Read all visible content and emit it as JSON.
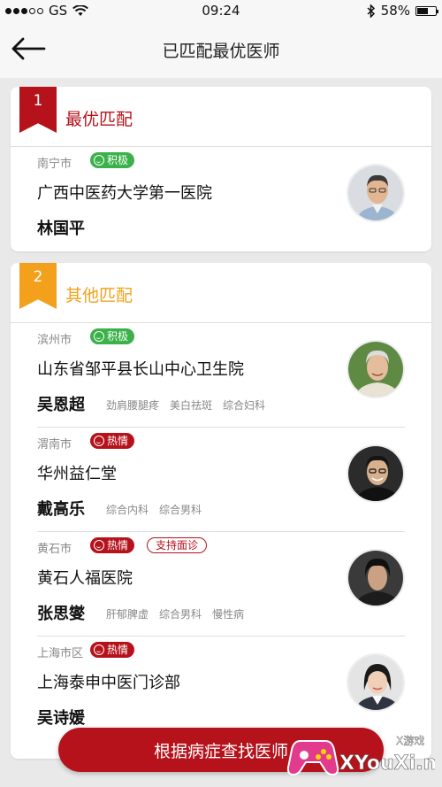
{
  "statusbar": {
    "carrier": "GS",
    "time": "09:24",
    "battery": "58%"
  },
  "nav": {
    "title": "已匹配最优医师"
  },
  "best": {
    "rank": "1",
    "title": "最优匹配",
    "doctor": {
      "city": "南宁市",
      "tag": "积极",
      "hospital": "广西中医药大学第一医院",
      "name": "林国平"
    }
  },
  "others": {
    "rank": "2",
    "title": "其他匹配",
    "doctors": [
      {
        "city": "滨州市",
        "tag": "积极",
        "hospital": "山东省邹平县长山中心卫生院",
        "name": "吴恩超",
        "skills": [
          "劲肩腰腿疼",
          "美白祛斑",
          "综合妇科"
        ]
      },
      {
        "city": "渭南市",
        "tag": "热情",
        "hospital": "华州益仁堂",
        "name": "戴高乐",
        "skills": [
          "综合内科",
          "综合男科"
        ]
      },
      {
        "city": "黄石市",
        "tag": "热情",
        "extra_tag": "支持面诊",
        "hospital": "黄石人福医院",
        "name": "张思燮",
        "skills": [
          "肝郁脾虚",
          "综合男科",
          "慢性病"
        ]
      },
      {
        "city": "上海市区",
        "tag": "热情",
        "hospital": "上海泰申中医门诊部",
        "name": "吴诗媛",
        "skills": []
      }
    ]
  },
  "button": {
    "label": "根据病症查找医师"
  },
  "watermark": {
    "top": "X游戏",
    "site": "XYouXi.net"
  },
  "colors": {
    "brand_red": "#b5121b",
    "accent_orange": "#f3a11c",
    "positive_green": "#3bb14a"
  }
}
